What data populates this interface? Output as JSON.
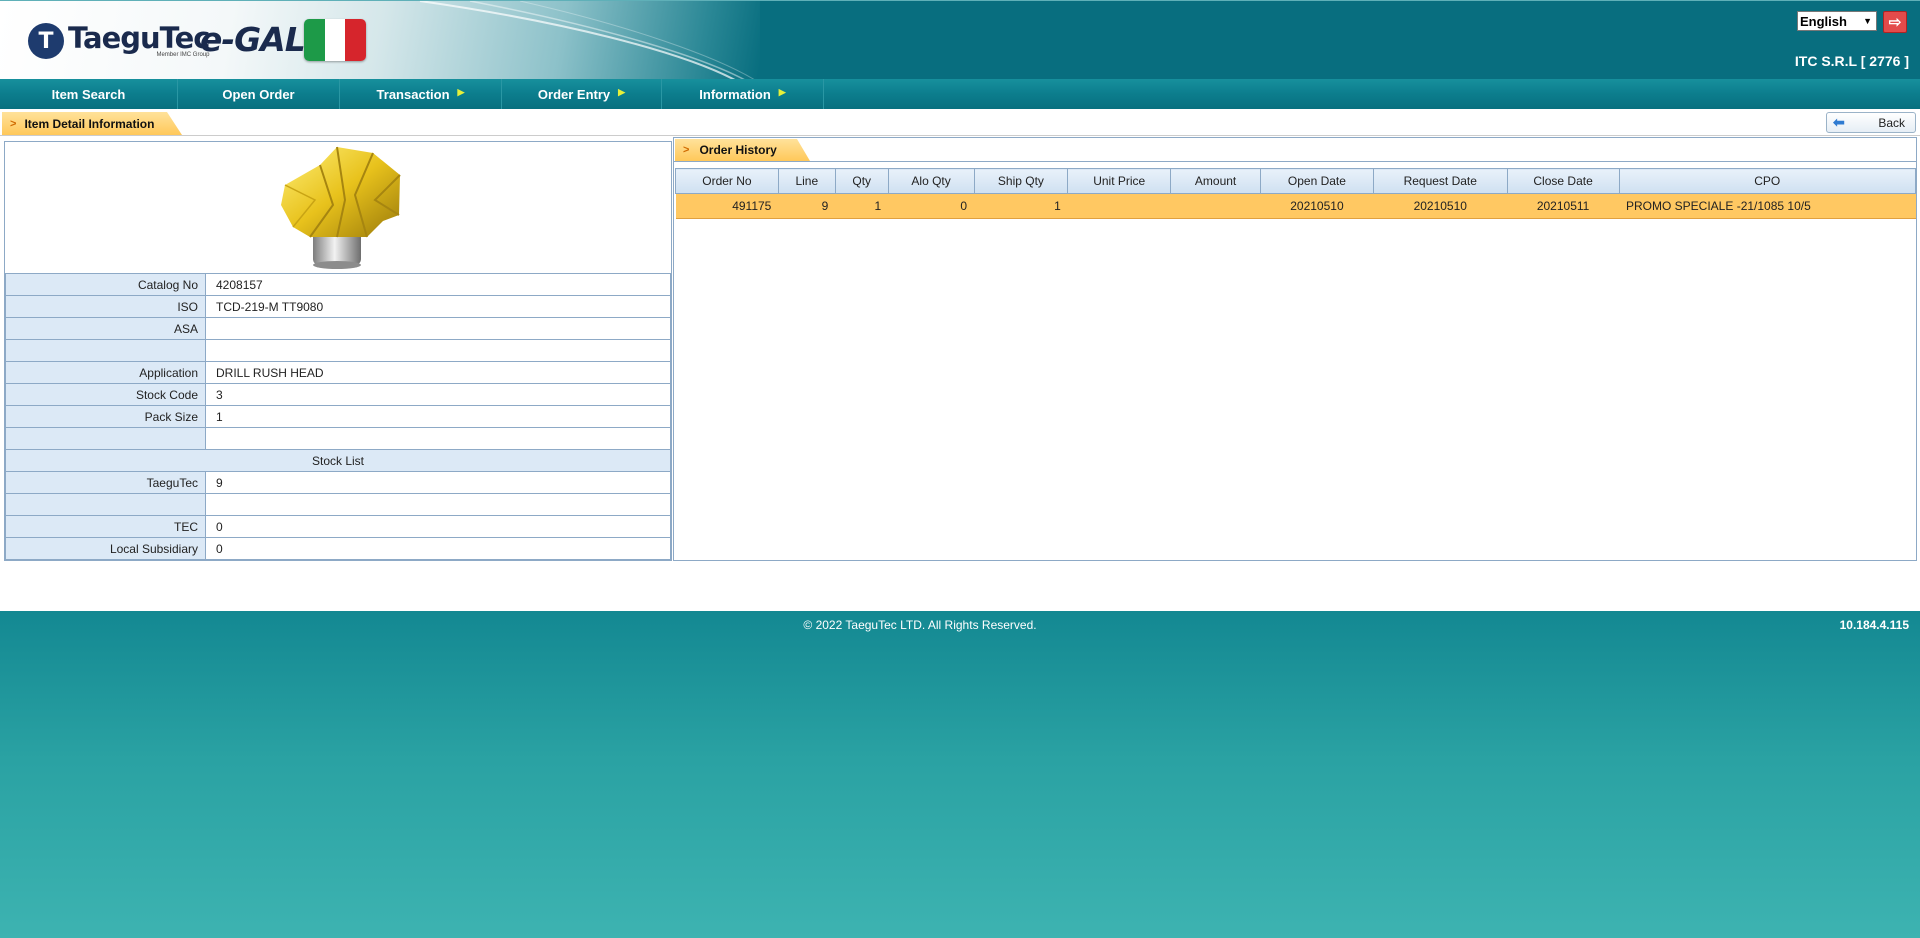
{
  "header": {
    "brand": "TaeguTec",
    "brand_sub": "Member IMC Group",
    "product": "e-GAL",
    "language": "English",
    "company": "ITC S.R.L [ 2776 ]",
    "flag_colors": [
      "#1d9a48",
      "#ffffff",
      "#d6252c"
    ]
  },
  "nav": {
    "items": [
      {
        "label": "Item Search",
        "has_submenu": false
      },
      {
        "label": "Open Order",
        "has_submenu": false
      },
      {
        "label": "Transaction",
        "has_submenu": true
      },
      {
        "label": "Order Entry",
        "has_submenu": true
      },
      {
        "label": "Information",
        "has_submenu": true
      }
    ]
  },
  "page": {
    "title": "Item Detail Information",
    "back_label": "Back"
  },
  "detail": {
    "rows": [
      {
        "label": "Catalog No",
        "value": "4208157"
      },
      {
        "label": "ISO",
        "value": "TCD-219-M TT9080"
      },
      {
        "label": "ASA",
        "value": ""
      },
      {
        "label": "",
        "value": ""
      },
      {
        "label": "Application",
        "value": "DRILL RUSH HEAD"
      },
      {
        "label": "Stock Code",
        "value": "3"
      },
      {
        "label": "Pack Size",
        "value": "1"
      },
      {
        "label": "",
        "value": ""
      }
    ],
    "stock_section": "Stock List",
    "stock_rows": [
      {
        "label": "TaeguTec",
        "value": "9"
      },
      {
        "label": "",
        "value": ""
      },
      {
        "label": "TEC",
        "value": "0"
      },
      {
        "label": "Local Subsidiary",
        "value": "0"
      }
    ]
  },
  "order_history": {
    "title": "Order History",
    "columns": [
      "Order No",
      "Line",
      "Qty",
      "Alo Qty",
      "Ship Qty",
      "Unit Price",
      "Amount",
      "Open Date",
      "Request Date",
      "Close Date",
      "CPO"
    ],
    "rows": [
      {
        "order_no": "491175",
        "line": "9",
        "qty": "1",
        "alo_qty": "0",
        "ship_qty": "1",
        "unit_price": "",
        "amount": "",
        "open_date": "20210510",
        "request_date": "20210510",
        "close_date": "20210511",
        "cpo": "PROMO SPECIALE -21/1085 10/5"
      }
    ]
  },
  "footer": {
    "copyright": "© 2022 TaeguTec LTD. All Rights Reserved.",
    "ip": "10.184.4.115"
  }
}
